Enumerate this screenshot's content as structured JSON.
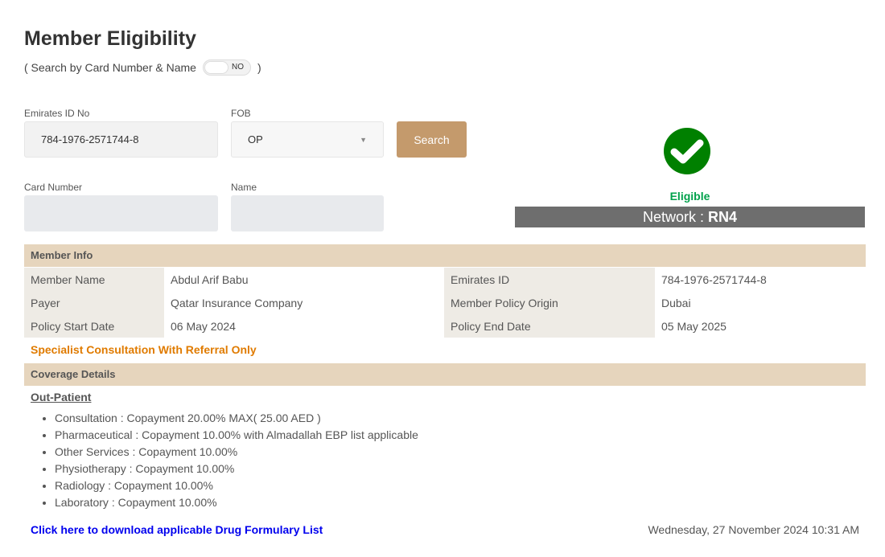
{
  "page_title": "Member Eligibility",
  "toggle": {
    "prefix": "( Search by Card Number & Name",
    "suffix": ")",
    "state": "NO"
  },
  "form": {
    "emirates_id_label": "Emirates ID No",
    "emirates_id_value": "784-1976-2571744-8",
    "fob_label": "FOB",
    "fob_value": "OP",
    "search_label": "Search",
    "card_number_label": "Card Number",
    "card_number_value": "",
    "name_label": "Name",
    "name_value": ""
  },
  "status": {
    "eligible_text": "Eligible",
    "network_prefix": "Network : ",
    "network_value": "RN4",
    "color": "#008000"
  },
  "member_info": {
    "header": "Member Info",
    "rows": [
      [
        "Member Name",
        "Abdul Arif Babu",
        "Emirates ID",
        "784-1976-2571744-8"
      ],
      [
        "Payer",
        "Qatar Insurance Company",
        "Member Policy Origin",
        "Dubai"
      ],
      [
        "Policy Start Date",
        "06 May 2024",
        "Policy End Date",
        "05 May 2025"
      ]
    ],
    "note": "Specialist Consultation With Referral Only"
  },
  "coverage": {
    "header": "Coverage Details",
    "subheader": "Out-Patient",
    "items": [
      "Consultation : Copayment 20.00% MAX( 25.00 AED )",
      "Pharmaceutical : Copayment 10.00% with Almadallah EBP list applicable",
      "Other Services : Copayment 10.00%",
      "Physiotherapy : Copayment 10.00%",
      "Radiology : Copayment 10.00%",
      "Laboratory : Copayment 10.00%"
    ]
  },
  "footer": {
    "download_link": "Click here to download applicable Drug Formulary List",
    "datetime": "Wednesday, 27 November 2024 10:31 AM"
  }
}
